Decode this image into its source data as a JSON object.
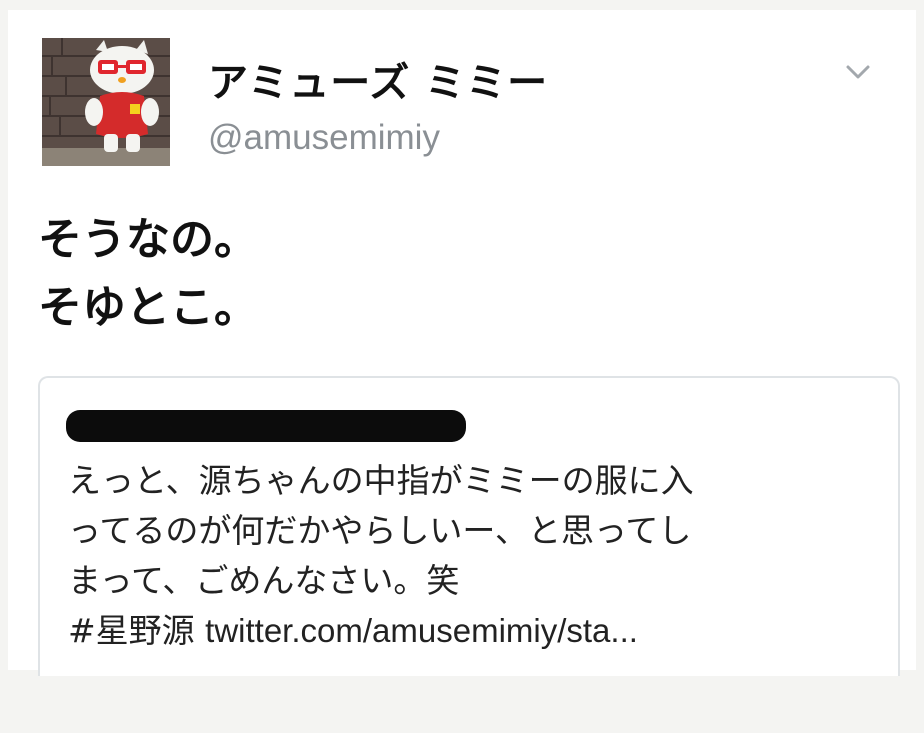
{
  "tweet": {
    "display_name": "アミューズ ミミー",
    "handle": "@amusemimiy",
    "text_lines": [
      "そうなの。",
      "そゆとこ。"
    ],
    "menu_icon": "chevron-down-icon",
    "avatar_icon": "mimiy-cat-mascot"
  },
  "quoted_tweet": {
    "author_redacted": true,
    "text_lines": [
      "えっと、源ちゃんの中指がミミーの服に入",
      "ってるのが何だかやらしいー、と思ってし",
      "まって、ごめんなさい。笑"
    ],
    "hashtag": "#星野源",
    "link": "twitter.com/amusemimiy/sta..."
  },
  "colors": {
    "handle": "#8a8f94",
    "border": "#dfe3e6",
    "avatar_shirt": "#d42b2b",
    "avatar_glasses": "#e0262e"
  }
}
